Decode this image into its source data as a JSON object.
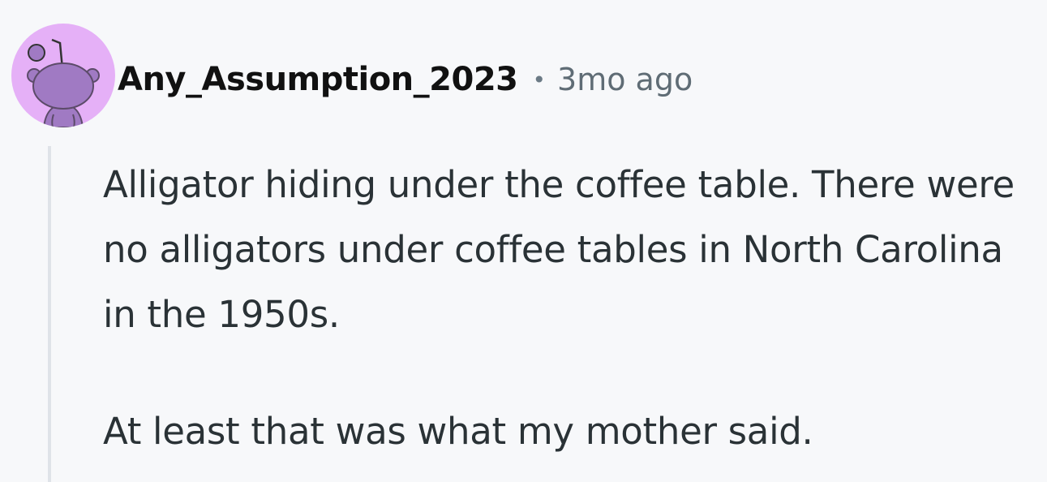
{
  "comment": {
    "author": "Any_Assumption_2023",
    "separator": "•",
    "time": "3mo ago",
    "paragraphs": [
      "Alligator hiding under the coffee table. There were no alligators under coffee tables in North Carolina in the 1950s.",
      "At least that was what my mother said."
    ],
    "avatar": {
      "icon": "snoo-avatar-icon",
      "background": "#e5b0f7",
      "figure": "#a07ac3"
    }
  }
}
